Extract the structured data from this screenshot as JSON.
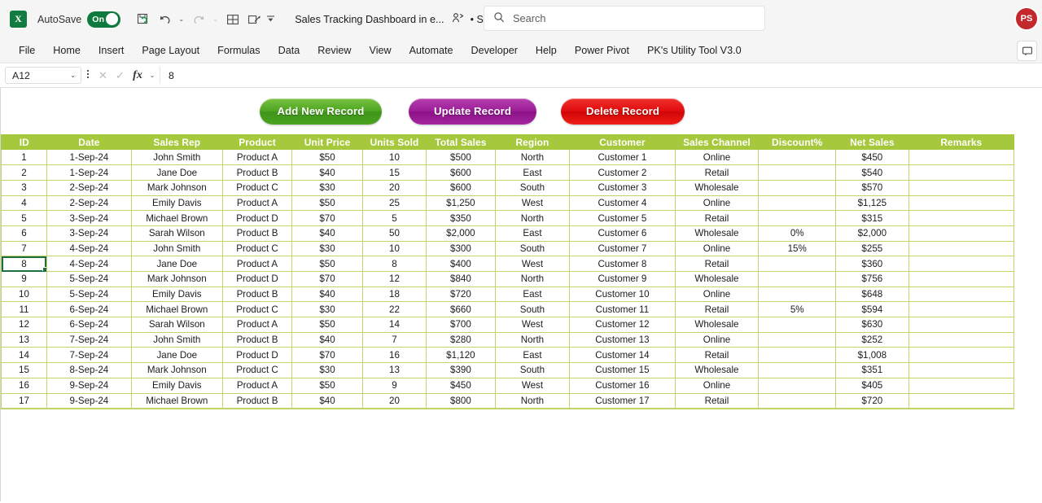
{
  "titlebar": {
    "app_logo": "excel-logo",
    "logo_text": "X",
    "autosave_label": "AutoSave",
    "autosave_state": "On",
    "document_title": "Sales Tracking Dashboard in e...",
    "share_icon": "share-people-icon",
    "saved_status": "• Saved",
    "saved_caret": "⌄",
    "icons": [
      {
        "name": "save-sync-icon",
        "glyph": "▤"
      },
      {
        "name": "undo-icon",
        "glyph": "↶"
      },
      {
        "name": "undo-dropdown-caret",
        "glyph": "⌄"
      },
      {
        "name": "redo-icon",
        "glyph": "↷"
      },
      {
        "name": "redo-dropdown-caret",
        "glyph": "⌄"
      },
      {
        "name": "table-grid-icon",
        "glyph": "⊞"
      },
      {
        "name": "touch-draw-icon",
        "glyph": "✎"
      },
      {
        "name": "customize-toolbar-caret",
        "glyph": "⌄"
      }
    ],
    "search": {
      "icon": "search-icon",
      "placeholder": "Search",
      "value": ""
    },
    "avatar_initials": "PS"
  },
  "ribbon": {
    "tabs": [
      "File",
      "Home",
      "Insert",
      "Page Layout",
      "Formulas",
      "Data",
      "Review",
      "View",
      "Automate",
      "Developer",
      "Help",
      "Power Pivot",
      "PK's Utility Tool V3.0"
    ],
    "comments_icon": "comments-icon"
  },
  "formula_bar": {
    "name_box_value": "A12",
    "name_box_caret": "⌄",
    "more_dots": "⋮",
    "cancel_icon": "✕",
    "confirm_icon": "✓",
    "fx_label": "fx",
    "fx_caret": "⌄",
    "formula_value": "8"
  },
  "actions": {
    "add_label": "Add New Record",
    "update_label": "Update Record",
    "delete_label": "Delete Record",
    "add_color": "#4da520",
    "update_color": "#9c1d96",
    "delete_color": "#e00d0d"
  },
  "table": {
    "header_color": "#a6c83c",
    "gridline_color": "#c3d368",
    "selected_cell": "A12",
    "columns": [
      "ID",
      "Date",
      "Sales Rep",
      "Product",
      "Unit Price",
      "Units Sold",
      "Total Sales",
      "Region",
      "Customer",
      "Sales Channel",
      "Discount%",
      "Net Sales",
      "Remarks"
    ],
    "rows": [
      [
        "1",
        "1-Sep-24",
        "John Smith",
        "Product A",
        "$50",
        "10",
        "$500",
        "North",
        "Customer 1",
        "Online",
        "",
        "$450",
        ""
      ],
      [
        "2",
        "1-Sep-24",
        "Jane Doe",
        "Product B",
        "$40",
        "15",
        "$600",
        "East",
        "Customer 2",
        "Retail",
        "",
        "$540",
        ""
      ],
      [
        "3",
        "2-Sep-24",
        "Mark Johnson",
        "Product C",
        "$30",
        "20",
        "$600",
        "South",
        "Customer 3",
        "Wholesale",
        "",
        "$570",
        ""
      ],
      [
        "4",
        "2-Sep-24",
        "Emily Davis",
        "Product A",
        "$50",
        "25",
        "$1,250",
        "West",
        "Customer 4",
        "Online",
        "",
        "$1,125",
        ""
      ],
      [
        "5",
        "3-Sep-24",
        "Michael Brown",
        "Product D",
        "$70",
        "5",
        "$350",
        "North",
        "Customer 5",
        "Retail",
        "",
        "$315",
        ""
      ],
      [
        "6",
        "3-Sep-24",
        "Sarah Wilson",
        "Product B",
        "$40",
        "50",
        "$2,000",
        "East",
        "Customer 6",
        "Wholesale",
        "0%",
        "$2,000",
        ""
      ],
      [
        "7",
        "4-Sep-24",
        "John Smith",
        "Product C",
        "$30",
        "10",
        "$300",
        "South",
        "Customer 7",
        "Online",
        "15%",
        "$255",
        ""
      ],
      [
        "8",
        "4-Sep-24",
        "Jane Doe",
        "Product A",
        "$50",
        "8",
        "$400",
        "West",
        "Customer 8",
        "Retail",
        "",
        "$360",
        ""
      ],
      [
        "9",
        "5-Sep-24",
        "Mark Johnson",
        "Product D",
        "$70",
        "12",
        "$840",
        "North",
        "Customer 9",
        "Wholesale",
        "",
        "$756",
        ""
      ],
      [
        "10",
        "5-Sep-24",
        "Emily Davis",
        "Product B",
        "$40",
        "18",
        "$720",
        "East",
        "Customer 10",
        "Online",
        "",
        "$648",
        ""
      ],
      [
        "11",
        "6-Sep-24",
        "Michael Brown",
        "Product C",
        "$30",
        "22",
        "$660",
        "South",
        "Customer 11",
        "Retail",
        "5%",
        "$594",
        ""
      ],
      [
        "12",
        "6-Sep-24",
        "Sarah Wilson",
        "Product A",
        "$50",
        "14",
        "$700",
        "West",
        "Customer 12",
        "Wholesale",
        "",
        "$630",
        ""
      ],
      [
        "13",
        "7-Sep-24",
        "John Smith",
        "Product B",
        "$40",
        "7",
        "$280",
        "North",
        "Customer 13",
        "Online",
        "",
        "$252",
        ""
      ],
      [
        "14",
        "7-Sep-24",
        "Jane Doe",
        "Product D",
        "$70",
        "16",
        "$1,120",
        "East",
        "Customer 14",
        "Retail",
        "",
        "$1,008",
        ""
      ],
      [
        "15",
        "8-Sep-24",
        "Mark Johnson",
        "Product C",
        "$30",
        "13",
        "$390",
        "South",
        "Customer 15",
        "Wholesale",
        "",
        "$351",
        ""
      ],
      [
        "16",
        "9-Sep-24",
        "Emily Davis",
        "Product A",
        "$50",
        "9",
        "$450",
        "West",
        "Customer 16",
        "Online",
        "",
        "$405",
        ""
      ],
      [
        "17",
        "9-Sep-24",
        "Michael Brown",
        "Product B",
        "$40",
        "20",
        "$800",
        "North",
        "Customer 17",
        "Retail",
        "",
        "$720",
        ""
      ]
    ],
    "selected_row_index": 7,
    "selected_col_index": 0
  }
}
